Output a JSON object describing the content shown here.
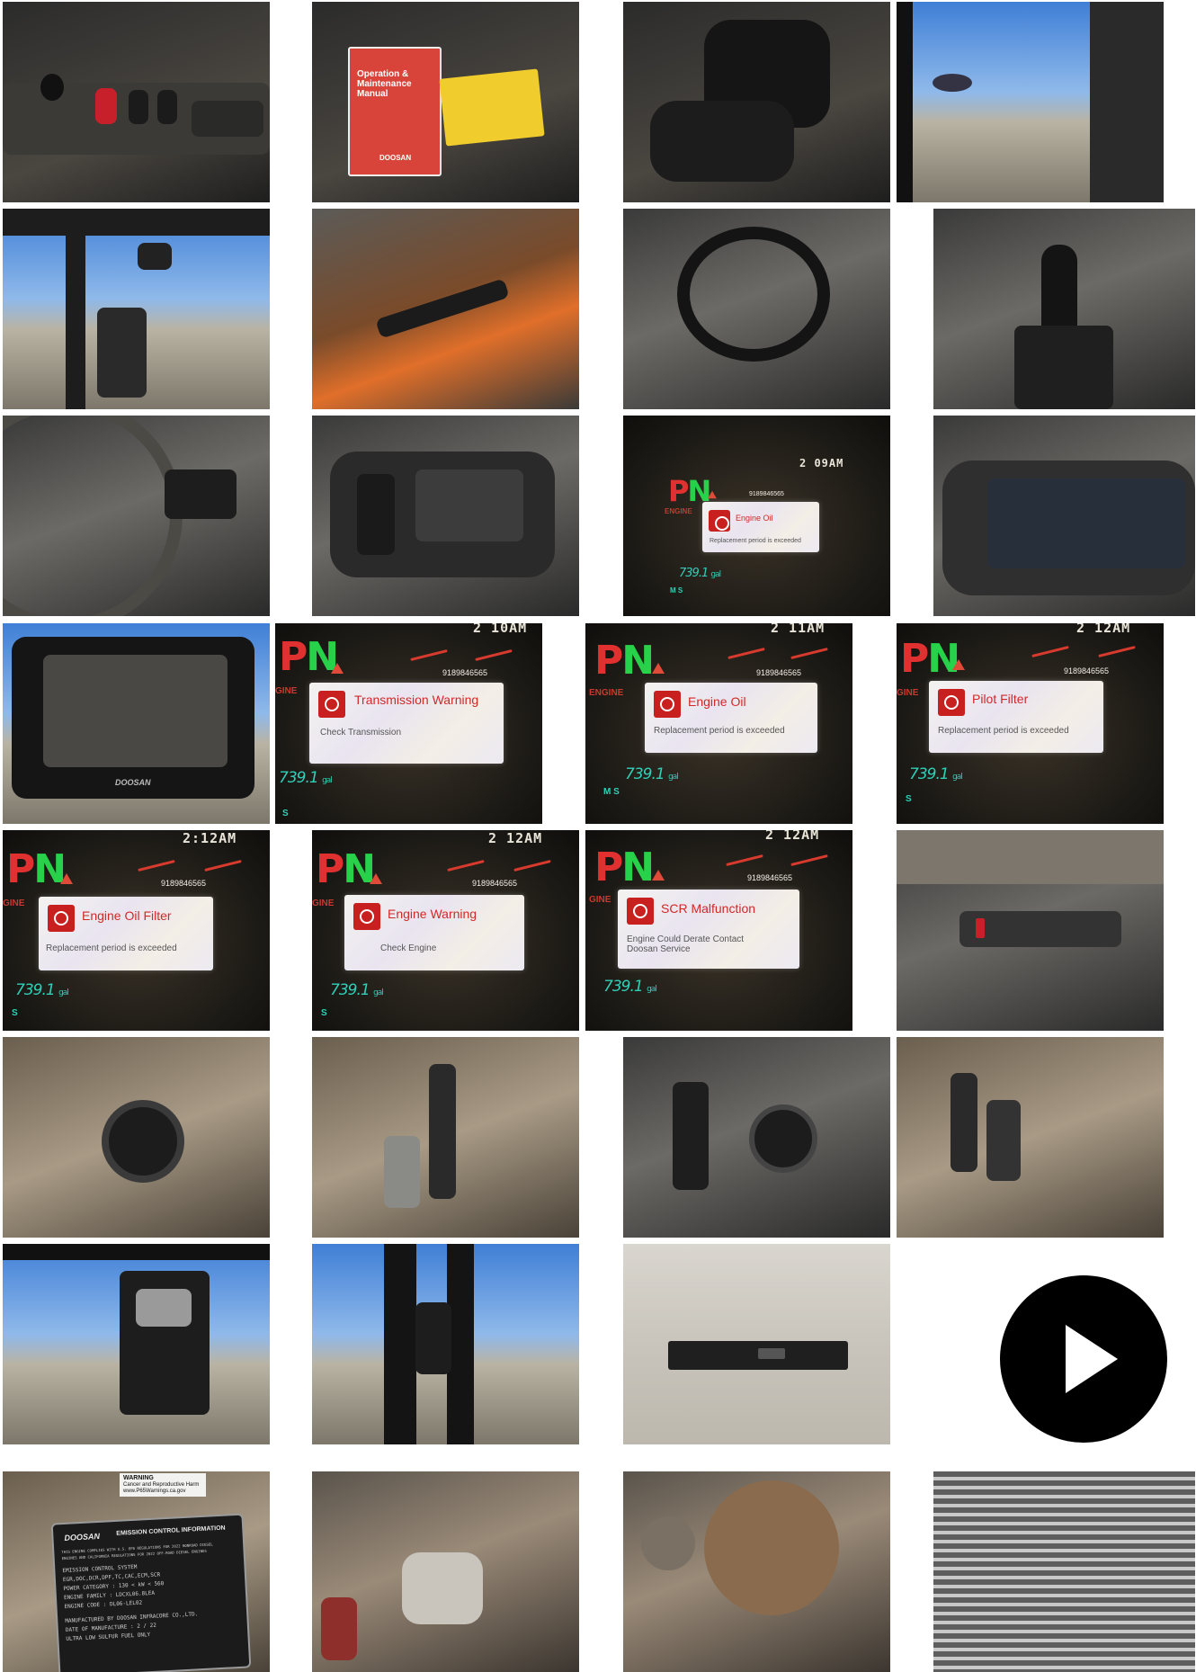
{
  "gallery": {
    "manual": {
      "manual_title": "Operation & Maintenance Manual",
      "brand": "DOOSAN"
    },
    "dash_row3": {
      "time": "2 09AM",
      "phone": "9189846565",
      "alert_title": "Engine Oil",
      "alert_message": "Replacement period is exceeded",
      "fuel_value": "739.1",
      "fuel_unit": "gal",
      "mode": "M S"
    },
    "monitor_row4_brand": "DOOSAN",
    "dash_transmission": {
      "time": "2 10AM",
      "phone": "9189846565",
      "alert_title": "Transmission Warning",
      "alert_message": "Check Transmission",
      "fuel_value": "739.1",
      "fuel_unit": "gal",
      "mode": "S"
    },
    "dash_engine_oil": {
      "time": "2 11AM",
      "phone": "9189846565",
      "alert_title": "Engine Oil",
      "alert_message": "Replacement period is exceeded",
      "fuel_value": "739.1",
      "fuel_unit": "gal",
      "mode": "M S"
    },
    "dash_pilot_filter": {
      "time": "2 12AM",
      "phone": "9189846565",
      "alert_title": "Pilot Filter",
      "alert_message": "Replacement period is exceeded",
      "fuel_value": "739.1",
      "fuel_unit": "gal",
      "mode": "S"
    },
    "dash_engine_oil_filter": {
      "time": "2:12AM",
      "phone": "9189846565",
      "alert_title": "Engine Oil Filter",
      "alert_message": "Replacement period is exceeded",
      "fuel_value": "739.1",
      "fuel_unit": "gal",
      "mode": "S"
    },
    "dash_engine_warning": {
      "time": "2 12AM",
      "phone": "9189846565",
      "alert_title": "Engine Warning",
      "alert_message": "Check Engine",
      "fuel_value": "739.1",
      "fuel_unit": "gal",
      "mode": "S"
    },
    "dash_scr": {
      "time": "2 12AM",
      "phone": "9189846565",
      "alert_title": "SCR Malfunction",
      "alert_message": "Engine Could Derate Contact Doosan Service",
      "fuel_value": "739.1",
      "fuel_unit": "gal",
      "mode": ""
    },
    "emission_plate": {
      "warning_label": "WARNING",
      "warning_text": "Cancer and Reproductive Harm www.P65Warnings.ca.gov",
      "brand": "DOOSAN",
      "heading": "EMISSION CONTROL INFORMATION",
      "line1": "THIS ENGINE COMPLIES WITH U.S. EPA REGULATIONS FOR 2022 NONROAD DIESEL",
      "line2": "ENGINES AND CALIFORNIA REGULATIONS FOR 2022 OFF-ROAD DIESEL ENGINES",
      "line3": "EMISSION CONTROL SYSTEM",
      "line4": "EGR,DOC,DCR,DPF,TC,CAC,ECM,SCR",
      "line5": "POWER CATEGORY : 130 < kW < 560",
      "line6": "ENGINE FAMILY : LDCXL06.8LEA",
      "line7": "ENGINE CODE : DL06-LEL02",
      "line8": "MANUFACTURED BY DOOSAN INFRACORE CO.,LTD.",
      "line9": "DATE OF MANUFACTURE : 2 / 22",
      "line10": "ULTRA LOW SULFUR FUEL ONLY"
    },
    "video_label": "Play video"
  }
}
